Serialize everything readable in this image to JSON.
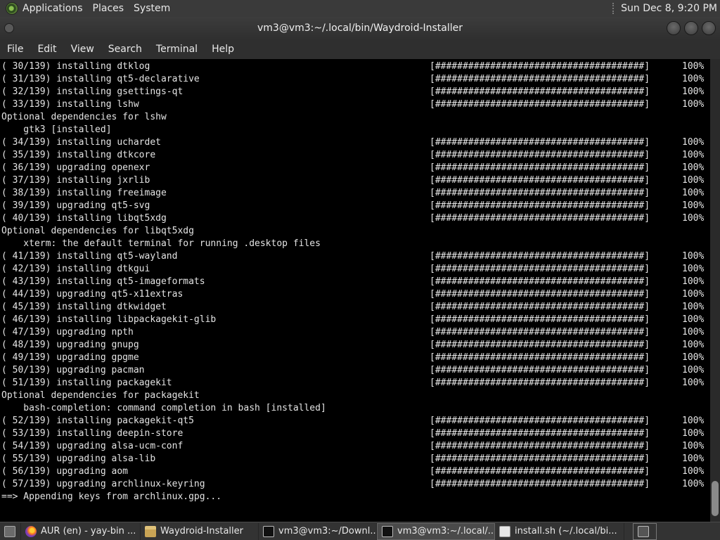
{
  "top_panel": {
    "menus": [
      "Applications",
      "Places",
      "System"
    ],
    "clock": "Sun Dec  8,  9:20 PM"
  },
  "window": {
    "title": "vm3@vm3:~/.local/bin/Waydroid-Installer",
    "menu": [
      "File",
      "Edit",
      "View",
      "Search",
      "Terminal",
      "Help"
    ]
  },
  "terminal": {
    "lines": [
      {
        "text": "( 30/139) installing dtklog",
        "bar": "[######################################]",
        "pct": "100%"
      },
      {
        "text": "( 31/139) installing qt5-declarative",
        "bar": "[######################################]",
        "pct": "100%"
      },
      {
        "text": "( 32/139) installing gsettings-qt",
        "bar": "[######################################]",
        "pct": "100%"
      },
      {
        "text": "( 33/139) installing lshw",
        "bar": "[######################################]",
        "pct": "100%"
      },
      {
        "text": "Optional dependencies for lshw"
      },
      {
        "text": "    gtk3 [installed]"
      },
      {
        "text": "( 34/139) installing uchardet",
        "bar": "[######################################]",
        "pct": "100%"
      },
      {
        "text": "( 35/139) installing dtkcore",
        "bar": "[######################################]",
        "pct": "100%"
      },
      {
        "text": "( 36/139) upgrading openexr",
        "bar": "[######################################]",
        "pct": "100%"
      },
      {
        "text": "( 37/139) installing jxrlib",
        "bar": "[######################################]",
        "pct": "100%"
      },
      {
        "text": "( 38/139) installing freeimage",
        "bar": "[######################################]",
        "pct": "100%"
      },
      {
        "text": "( 39/139) upgrading qt5-svg",
        "bar": "[######################################]",
        "pct": "100%"
      },
      {
        "text": "( 40/139) installing libqt5xdg",
        "bar": "[######################################]",
        "pct": "100%"
      },
      {
        "text": "Optional dependencies for libqt5xdg"
      },
      {
        "text": "    xterm: the default terminal for running .desktop files"
      },
      {
        "text": "( 41/139) installing qt5-wayland",
        "bar": "[######################################]",
        "pct": "100%"
      },
      {
        "text": "( 42/139) installing dtkgui",
        "bar": "[######################################]",
        "pct": "100%"
      },
      {
        "text": "( 43/139) installing qt5-imageformats",
        "bar": "[######################################]",
        "pct": "100%"
      },
      {
        "text": "( 44/139) upgrading qt5-x11extras",
        "bar": "[######################################]",
        "pct": "100%"
      },
      {
        "text": "( 45/139) installing dtkwidget",
        "bar": "[######################################]",
        "pct": "100%"
      },
      {
        "text": "( 46/139) installing libpackagekit-glib",
        "bar": "[######################################]",
        "pct": "100%"
      },
      {
        "text": "( 47/139) upgrading npth",
        "bar": "[######################################]",
        "pct": "100%"
      },
      {
        "text": "( 48/139) upgrading gnupg",
        "bar": "[######################################]",
        "pct": "100%"
      },
      {
        "text": "( 49/139) upgrading gpgme",
        "bar": "[######################################]",
        "pct": "100%"
      },
      {
        "text": "( 50/139) upgrading pacman",
        "bar": "[######################################]",
        "pct": "100%"
      },
      {
        "text": "( 51/139) installing packagekit",
        "bar": "[######################################]",
        "pct": "100%"
      },
      {
        "text": "Optional dependencies for packagekit"
      },
      {
        "text": "    bash-completion: command completion in bash [installed]"
      },
      {
        "text": "( 52/139) installing packagekit-qt5",
        "bar": "[######################################]",
        "pct": "100%"
      },
      {
        "text": "( 53/139) installing deepin-store",
        "bar": "[######################################]",
        "pct": "100%"
      },
      {
        "text": "( 54/139) upgrading alsa-ucm-conf",
        "bar": "[######################################]",
        "pct": "100%"
      },
      {
        "text": "( 55/139) upgrading alsa-lib",
        "bar": "[######################################]",
        "pct": "100%"
      },
      {
        "text": "( 56/139) upgrading aom",
        "bar": "[######################################]",
        "pct": "100%"
      },
      {
        "text": "( 57/139) upgrading archlinux-keyring",
        "bar": "[######################################]",
        "pct": "100%"
      },
      {
        "text": "==> Appending keys from archlinux.gpg..."
      }
    ]
  },
  "taskbar": {
    "items": [
      {
        "icon": "show-desktop-icon",
        "label": ""
      },
      {
        "icon": "firefox-icon",
        "label": "AUR (en) - yay-bin ..."
      },
      {
        "icon": "folder-icon",
        "label": "Waydroid-Installer"
      },
      {
        "icon": "terminal-icon",
        "label": "vm3@vm3:~/Downl..."
      },
      {
        "icon": "terminal-icon",
        "label": "vm3@vm3:~/.local/..."
      },
      {
        "icon": "text-editor-icon",
        "label": "install.sh (~/.local/bi..."
      },
      {
        "icon": "workspace-icon",
        "label": ""
      }
    ]
  }
}
